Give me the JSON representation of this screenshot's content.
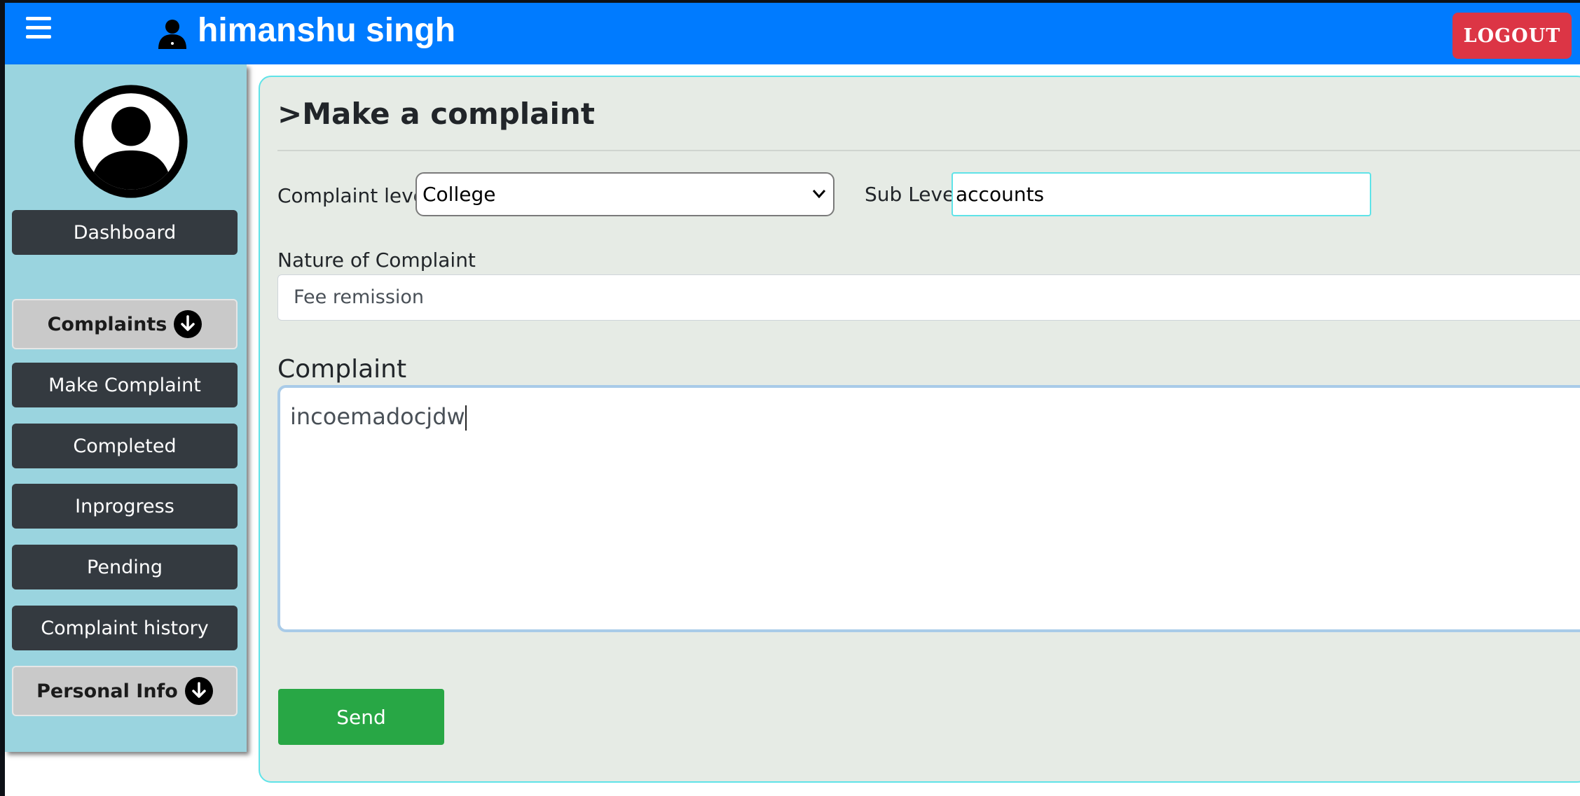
{
  "navbar": {
    "user_name": "himanshu singh",
    "logout_label": "LOGOUT",
    "icons": [
      "hamburger-menu-icon",
      "user-icon"
    ]
  },
  "sidebar": {
    "avatar_icon": "avatar-icon",
    "items": [
      {
        "label": "Dashboard",
        "style": "dark"
      },
      {
        "label": "Complaints",
        "style": "light",
        "icon": "arrow-down-circle-icon"
      },
      {
        "label": "Make Complaint",
        "style": "dark"
      },
      {
        "label": "Completed",
        "style": "dark"
      },
      {
        "label": "Inprogress",
        "style": "dark"
      },
      {
        "label": "Pending",
        "style": "dark"
      },
      {
        "label": "Complaint history",
        "style": "dark"
      },
      {
        "label": "Personal Info",
        "style": "light",
        "icon": "arrow-down-circle-icon"
      }
    ]
  },
  "form": {
    "title": ">Make a complaint",
    "complaint_level_label": "Complaint level",
    "complaint_level_value": "College",
    "sub_level_label": "Sub Level",
    "sub_level_value": "accounts",
    "nature_label": "Nature of Complaint",
    "nature_value": "Fee remission",
    "complaint_label": "Complaint",
    "complaint_value": "incoemadocjdw",
    "send_label": "Send"
  },
  "colors": {
    "navbar": "#007bff",
    "sidebar": "#9ad4df",
    "logout": "#dc3545",
    "send": "#28a745",
    "panel": "#e6ebe5",
    "dark_button": "#343a40"
  }
}
